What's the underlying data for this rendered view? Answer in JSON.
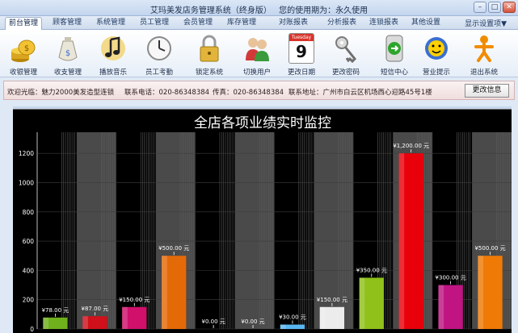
{
  "window": {
    "title": "艾玛美发店务管理系统（终身版）",
    "usage_label": "您的使用期为：永久使用"
  },
  "tabs": [
    {
      "label": "前台管理",
      "active": true
    },
    {
      "label": "顾客管理",
      "active": false
    },
    {
      "label": "系统管理",
      "active": false
    },
    {
      "label": "员工管理",
      "active": false
    },
    {
      "label": "会员管理",
      "active": false
    },
    {
      "label": "库存管理",
      "active": false
    },
    {
      "label": "对账报表",
      "active": false
    },
    {
      "label": "分析报表",
      "active": false
    },
    {
      "label": "连锁报表",
      "active": false
    },
    {
      "label": "其他设置",
      "active": false
    }
  ],
  "settings_menu": "显示设置项▼",
  "toolbar": [
    {
      "label": "收银管理",
      "icon": "coins-icon"
    },
    {
      "label": "收支管理",
      "icon": "money-bag-icon"
    },
    {
      "label": "播放音乐",
      "icon": "music-note-icon"
    },
    {
      "label": "员工考勤",
      "icon": "clock-icon"
    },
    {
      "label": "锁定系统",
      "icon": "padlock-icon"
    },
    {
      "label": "切换用户",
      "icon": "users-icon"
    },
    {
      "label": "更改日期",
      "icon": "calendar-icon",
      "calendar_day": "Tuesday",
      "calendar_date": "9"
    },
    {
      "label": "更改密码",
      "icon": "key-icon"
    },
    {
      "label": "短信中心",
      "icon": "sms-icon"
    },
    {
      "label": "营业提示",
      "icon": "smiley-icon"
    },
    {
      "label": "退出系统",
      "icon": "exit-icon"
    }
  ],
  "infobar": {
    "welcome": "欢迎光临：魅力2000美发造型连锁",
    "phone": "联系电话：020-86348384",
    "fax": "传真：020-86348384",
    "address": "联系地址：广州市白云区机场西心迎路45号1楼",
    "button": "更改信息"
  },
  "chart_data": {
    "type": "bar",
    "title": "全店各项业绩实时监控",
    "ylim": [
      0,
      1300
    ],
    "yticks": [
      0,
      200,
      400,
      600,
      800,
      1000,
      1200
    ],
    "grid": true,
    "values": [
      78,
      87,
      150,
      500,
      0,
      0,
      30,
      150,
      350,
      1200,
      300,
      500
    ],
    "value_labels": [
      "¥78.00 元",
      "¥87.00 元",
      "¥150.00 元",
      "¥500.00 元",
      "¥0.00 元",
      "¥0.00 元",
      "¥30.00 元",
      "¥150.00 元",
      "¥350.00 元",
      "¥1,200.00 元",
      "¥300.00 元",
      "¥500.00 元"
    ],
    "colors": [
      "#6fb01d",
      "#d0101b",
      "#d0106b",
      "#e46a08",
      "#9a9a9a",
      "#9a9a9a",
      "#58b6f0",
      "#ececec",
      "#8fc11a",
      "#e8000a",
      "#c01482",
      "#ef7a05"
    ],
    "background": "#000000",
    "band_color": "#4a4a4a"
  }
}
